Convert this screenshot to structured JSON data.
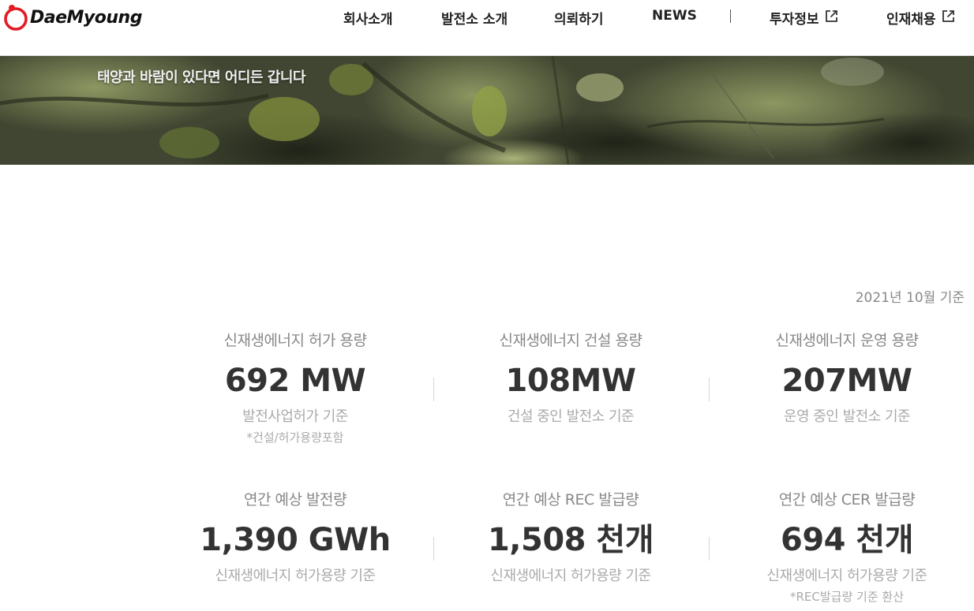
{
  "brand": {
    "name": "DaeMyoung",
    "accent": "#e31b23"
  },
  "nav": {
    "items": [
      {
        "label": "회사소개",
        "external": false
      },
      {
        "label": "발전소 소개",
        "external": false
      },
      {
        "label": "의뢰하기",
        "external": false
      },
      {
        "label": "NEWS",
        "external": false
      },
      {
        "label": "투자정보",
        "external": true
      },
      {
        "label": "인재채용",
        "external": true
      }
    ]
  },
  "hero": {
    "headline": "태양과 바람이 있다면 어디든 갑니다"
  },
  "stats": {
    "as_of": "2021년 10월 기준",
    "items": [
      {
        "label": "신재생에너지 허가 용량",
        "value": "692 MW",
        "basis": "발전사업허가 기준",
        "note": "*건설/허가용량포함"
      },
      {
        "label": "신재생에너지 건설 용량",
        "value": "108MW",
        "basis": "건설 중인 발전소 기준",
        "note": ""
      },
      {
        "label": "신재생에너지 운영 용량",
        "value": "207MW",
        "basis": "운영 중인 발전소 기준",
        "note": ""
      },
      {
        "label": "연간 예상 발전량",
        "value": "1,390 GWh",
        "basis": "신재생에너지 허가용량 기준",
        "note": ""
      },
      {
        "label": "연간 예상 REC 발급량",
        "value": "1,508 천개",
        "basis": "신재생에너지 허가용량 기준",
        "note": ""
      },
      {
        "label": "연간 예상 CER 발급량",
        "value": "694 천개",
        "basis": "신재생에너지 허가용량 기준",
        "note": "*REC발급량 기준 환산"
      }
    ]
  }
}
